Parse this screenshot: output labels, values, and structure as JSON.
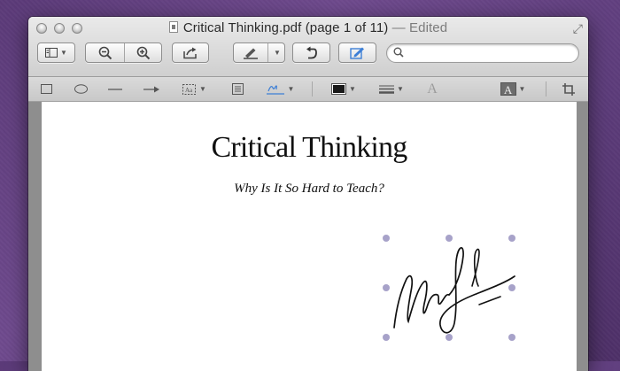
{
  "window": {
    "filename": "Critical Thinking.pdf",
    "page_info": "(page 1 of 11)",
    "edited_label": "— Edited"
  },
  "toolbar": {
    "view_icon": "sidebar-view-icon",
    "zoom_out_icon": "zoom-out-icon",
    "zoom_in_icon": "zoom-in-icon",
    "share_icon": "share-icon",
    "markup_pen_icon": "pen-icon",
    "rotate_icon": "rotate-icon",
    "annotate_icon": "annotate-icon",
    "search_placeholder": "",
    "search_value": ""
  },
  "markup_toolbar": {
    "tools": [
      "rectangle",
      "oval",
      "line",
      "arrow",
      "text-box",
      "note",
      "signature",
      "border-color",
      "line-style",
      "text-style",
      "fill-color",
      "crop"
    ],
    "text_tool_glyph": "A",
    "fill_tool_glyph": "A"
  },
  "document": {
    "title": "Critical Thinking",
    "subtitle": "Why Is It So Hard to Teach?"
  },
  "colors": {
    "desktop": "#5e3d7c",
    "selection_handle": "#a7a2c9",
    "annotate_active": "#3d7fd6"
  }
}
